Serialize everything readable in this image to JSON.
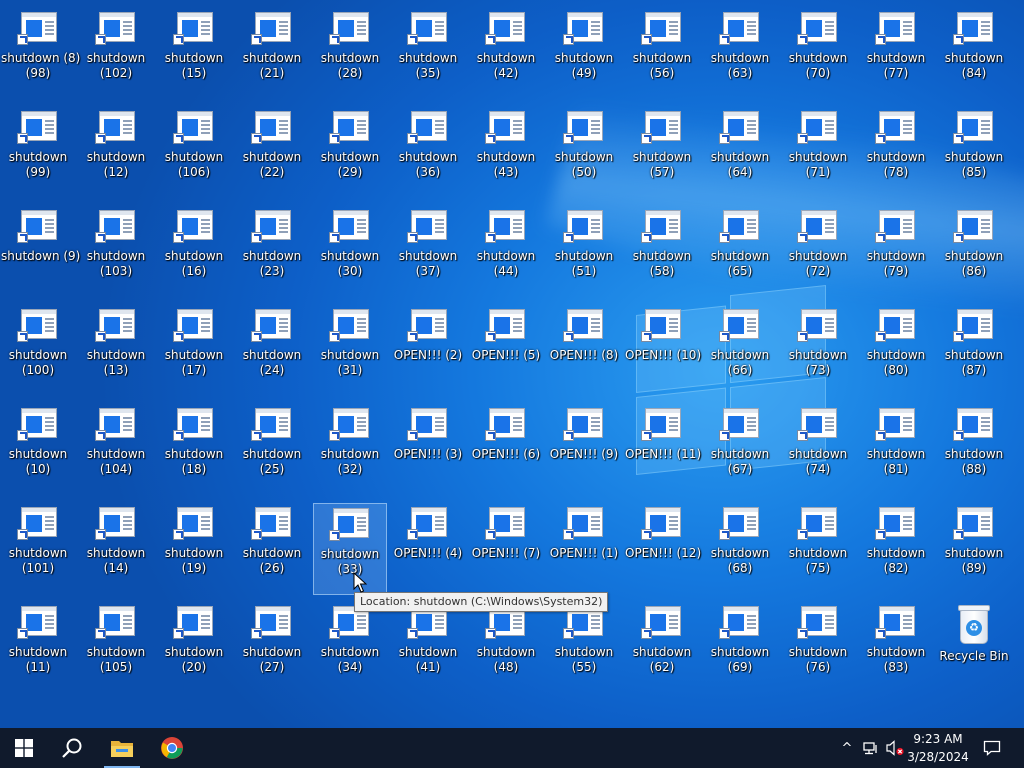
{
  "desktop": {
    "icons": [
      {
        "line1": "shutdown (8)",
        "line2": "(98)",
        "col": 0,
        "row": 0,
        "selected": true
      },
      {
        "line1": "shutdown",
        "line2": "(99)",
        "col": 0,
        "row": 1
      },
      {
        "line1": "shutdown (9)",
        "line2": "",
        "col": 0,
        "row": 2
      },
      {
        "line1": "shutdown",
        "line2": "(100)",
        "col": 0,
        "row": 3
      },
      {
        "line1": "shutdown",
        "line2": "(10)",
        "col": 0,
        "row": 4
      },
      {
        "line1": "shutdown",
        "line2": "(101)",
        "col": 0,
        "row": 5
      },
      {
        "line1": "shutdown",
        "line2": "(11)",
        "col": 0,
        "row": 6
      },
      {
        "line1": "shutdown",
        "line2": "(102)",
        "col": 1,
        "row": 0
      },
      {
        "line1": "shutdown",
        "line2": "(12)",
        "col": 1,
        "row": 1
      },
      {
        "line1": "shutdown",
        "line2": "(103)",
        "col": 1,
        "row": 2
      },
      {
        "line1": "shutdown",
        "line2": "(13)",
        "col": 1,
        "row": 3
      },
      {
        "line1": "shutdown",
        "line2": "(104)",
        "col": 1,
        "row": 4
      },
      {
        "line1": "shutdown",
        "line2": "(14)",
        "col": 1,
        "row": 5
      },
      {
        "line1": "shutdown",
        "line2": "(105)",
        "col": 1,
        "row": 6
      },
      {
        "line1": "shutdown",
        "line2": "(15)",
        "col": 2,
        "row": 0
      },
      {
        "line1": "shutdown",
        "line2": "(106)",
        "col": 2,
        "row": 1
      },
      {
        "line1": "shutdown",
        "line2": "(16)",
        "col": 2,
        "row": 2
      },
      {
        "line1": "shutdown",
        "line2": "(17)",
        "col": 2,
        "row": 3
      },
      {
        "line1": "shutdown",
        "line2": "(18)",
        "col": 2,
        "row": 4
      },
      {
        "line1": "shutdown",
        "line2": "(19)",
        "col": 2,
        "row": 5
      },
      {
        "line1": "shutdown",
        "line2": "(20)",
        "col": 2,
        "row": 6
      },
      {
        "line1": "shutdown",
        "line2": "(21)",
        "col": 3,
        "row": 0
      },
      {
        "line1": "shutdown",
        "line2": "(22)",
        "col": 3,
        "row": 1
      },
      {
        "line1": "shutdown",
        "line2": "(23)",
        "col": 3,
        "row": 2
      },
      {
        "line1": "shutdown",
        "line2": "(24)",
        "col": 3,
        "row": 3
      },
      {
        "line1": "shutdown",
        "line2": "(25)",
        "col": 3,
        "row": 4
      },
      {
        "line1": "shutdown",
        "line2": "(26)",
        "col": 3,
        "row": 5
      },
      {
        "line1": "shutdown",
        "line2": "(27)",
        "col": 3,
        "row": 6
      },
      {
        "line1": "shutdown",
        "line2": "(28)",
        "col": 4,
        "row": 0
      },
      {
        "line1": "shutdown",
        "line2": "(29)",
        "col": 4,
        "row": 1
      },
      {
        "line1": "shutdown",
        "line2": "(30)",
        "col": 4,
        "row": 2
      },
      {
        "line1": "shutdown",
        "line2": "(31)",
        "col": 4,
        "row": 3
      },
      {
        "line1": "shutdown",
        "line2": "(32)",
        "col": 4,
        "row": 4
      },
      {
        "line1": "shutdown",
        "line2": "(33)",
        "col": 4,
        "row": 5,
        "hover": true
      },
      {
        "line1": "shutdown",
        "line2": "(34)",
        "col": 4,
        "row": 6
      },
      {
        "line1": "shutdown",
        "line2": "(35)",
        "col": 5,
        "row": 0
      },
      {
        "line1": "shutdown",
        "line2": "(36)",
        "col": 5,
        "row": 1
      },
      {
        "line1": "shutdown",
        "line2": "(37)",
        "col": 5,
        "row": 2
      },
      {
        "line1": "OPEN!!! (2)",
        "line2": "",
        "col": 5,
        "row": 3
      },
      {
        "line1": "OPEN!!! (3)",
        "line2": "",
        "col": 5,
        "row": 4
      },
      {
        "line1": "OPEN!!! (4)",
        "line2": "",
        "col": 5,
        "row": 5
      },
      {
        "line1": "shutdown",
        "line2": "(41)",
        "col": 5,
        "row": 6
      },
      {
        "line1": "shutdown",
        "line2": "(42)",
        "col": 6,
        "row": 0
      },
      {
        "line1": "shutdown",
        "line2": "(43)",
        "col": 6,
        "row": 1
      },
      {
        "line1": "shutdown",
        "line2": "(44)",
        "col": 6,
        "row": 2
      },
      {
        "line1": "OPEN!!! (5)",
        "line2": "",
        "col": 6,
        "row": 3
      },
      {
        "line1": "OPEN!!! (6)",
        "line2": "",
        "col": 6,
        "row": 4
      },
      {
        "line1": "OPEN!!! (7)",
        "line2": "",
        "col": 6,
        "row": 5
      },
      {
        "line1": "shutdown",
        "line2": "(48)",
        "col": 6,
        "row": 6
      },
      {
        "line1": "shutdown",
        "line2": "(49)",
        "col": 7,
        "row": 0
      },
      {
        "line1": "shutdown",
        "line2": "(50)",
        "col": 7,
        "row": 1
      },
      {
        "line1": "shutdown",
        "line2": "(51)",
        "col": 7,
        "row": 2
      },
      {
        "line1": "OPEN!!! (8)",
        "line2": "",
        "col": 7,
        "row": 3
      },
      {
        "line1": "OPEN!!! (9)",
        "line2": "",
        "col": 7,
        "row": 4
      },
      {
        "line1": "OPEN!!! (1)",
        "line2": "",
        "col": 7,
        "row": 5
      },
      {
        "line1": "shutdown",
        "line2": "(55)",
        "col": 7,
        "row": 6
      },
      {
        "line1": "shutdown",
        "line2": "(56)",
        "col": 8,
        "row": 0
      },
      {
        "line1": "shutdown",
        "line2": "(57)",
        "col": 8,
        "row": 1
      },
      {
        "line1": "shutdown",
        "line2": "(58)",
        "col": 8,
        "row": 2
      },
      {
        "line1": "OPEN!!! (10)",
        "line2": "",
        "col": 8,
        "row": 3
      },
      {
        "line1": "OPEN!!! (11)",
        "line2": "",
        "col": 8,
        "row": 4
      },
      {
        "line1": "OPEN!!! (12)",
        "line2": "",
        "col": 8,
        "row": 5
      },
      {
        "line1": "shutdown",
        "line2": "(62)",
        "col": 8,
        "row": 6
      },
      {
        "line1": "shutdown",
        "line2": "(63)",
        "col": 9,
        "row": 0
      },
      {
        "line1": "shutdown",
        "line2": "(64)",
        "col": 9,
        "row": 1
      },
      {
        "line1": "shutdown",
        "line2": "(65)",
        "col": 9,
        "row": 2
      },
      {
        "line1": "shutdown",
        "line2": "(66)",
        "col": 9,
        "row": 3
      },
      {
        "line1": "shutdown",
        "line2": "(67)",
        "col": 9,
        "row": 4
      },
      {
        "line1": "shutdown",
        "line2": "(68)",
        "col": 9,
        "row": 5
      },
      {
        "line1": "shutdown",
        "line2": "(69)",
        "col": 9,
        "row": 6
      },
      {
        "line1": "shutdown",
        "line2": "(70)",
        "col": 10,
        "row": 0
      },
      {
        "line1": "shutdown",
        "line2": "(71)",
        "col": 10,
        "row": 1
      },
      {
        "line1": "shutdown",
        "line2": "(72)",
        "col": 10,
        "row": 2
      },
      {
        "line1": "shutdown",
        "line2": "(73)",
        "col": 10,
        "row": 3
      },
      {
        "line1": "shutdown",
        "line2": "(74)",
        "col": 10,
        "row": 4
      },
      {
        "line1": "shutdown",
        "line2": "(75)",
        "col": 10,
        "row": 5
      },
      {
        "line1": "shutdown",
        "line2": "(76)",
        "col": 10,
        "row": 6
      },
      {
        "line1": "shutdown",
        "line2": "(77)",
        "col": 11,
        "row": 0
      },
      {
        "line1": "shutdown",
        "line2": "(78)",
        "col": 11,
        "row": 1
      },
      {
        "line1": "shutdown",
        "line2": "(79)",
        "col": 11,
        "row": 2
      },
      {
        "line1": "shutdown",
        "line2": "(80)",
        "col": 11,
        "row": 3
      },
      {
        "line1": "shutdown",
        "line2": "(81)",
        "col": 11,
        "row": 4
      },
      {
        "line1": "shutdown",
        "line2": "(82)",
        "col": 11,
        "row": 5
      },
      {
        "line1": "shutdown",
        "line2": "(83)",
        "col": 11,
        "row": 6
      },
      {
        "line1": "shutdown",
        "line2": "(84)",
        "col": 12,
        "row": 0
      },
      {
        "line1": "shutdown",
        "line2": "(85)",
        "col": 12,
        "row": 1
      },
      {
        "line1": "shutdown",
        "line2": "(86)",
        "col": 12,
        "row": 2
      },
      {
        "line1": "shutdown",
        "line2": "(87)",
        "col": 12,
        "row": 3
      },
      {
        "line1": "shutdown",
        "line2": "(88)",
        "col": 12,
        "row": 4
      },
      {
        "line1": "shutdown",
        "line2": "(89)",
        "col": 12,
        "row": 5
      },
      {
        "line1": "Recycle Bin",
        "line2": "",
        "col": 12,
        "row": 6,
        "type": "recycle-bin"
      }
    ]
  },
  "tooltip": {
    "text": "Location: shutdown (C:\\Windows\\System32)"
  },
  "taskbar": {
    "start_icon": "windows-start-icon",
    "search_icon": "search-icon",
    "explorer_icon": "file-explorer-icon",
    "chrome_icon": "chrome-icon",
    "tray_chevron": "^",
    "time": "9:23 AM",
    "date": "3/28/2024"
  },
  "colors": {
    "accent": "#1a73e8",
    "taskbar": "#101a2c"
  }
}
